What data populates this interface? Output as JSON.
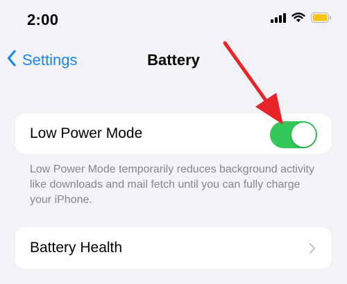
{
  "status_bar": {
    "time": "2:00",
    "icons": [
      "cellular-signal-icon",
      "wifi-icon",
      "battery-icon"
    ],
    "battery_color": "#f5c518"
  },
  "nav": {
    "back_label": "Settings",
    "title": "Battery"
  },
  "low_power_mode": {
    "label": "Low Power Mode",
    "enabled": true,
    "toggle_color": "#34c759",
    "footer": "Low Power Mode temporarily reduces background activity like downloads and mail fetch until you can fully charge your iPhone."
  },
  "battery_health": {
    "label": "Battery Health",
    "icon": "chevron-right-icon"
  },
  "annotation": {
    "icon": "red-arrow-icon",
    "color": "#e8262a"
  },
  "colors": {
    "background": "#f2f2f7",
    "accent": "#1a86e8"
  }
}
